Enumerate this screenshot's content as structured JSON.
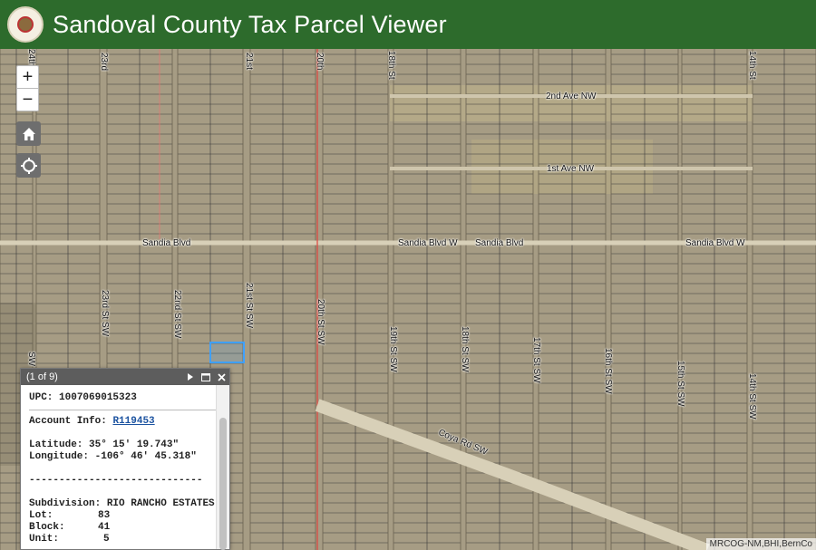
{
  "header": {
    "title": "Sandoval County Tax Parcel Viewer"
  },
  "map": {
    "attribution": "MRCOG-NM,BHI,BernCo",
    "streets_horizontal": [
      {
        "id": "2nd-ave-nw",
        "label": "2nd Ave NW"
      },
      {
        "id": "1st-ave-nw",
        "label": "1st Ave NW"
      },
      {
        "id": "sandia-blvd-left",
        "label": "Sandia Blvd"
      },
      {
        "id": "sandia-blvd-w-1",
        "label": "Sandia Blvd W"
      },
      {
        "id": "sandia-blvd-mid",
        "label": "Sandia Blvd"
      },
      {
        "id": "sandia-blvd-w-2",
        "label": "Sandia Blvd W"
      },
      {
        "id": "coya-rd-sw",
        "label": "Coya Rd SW"
      }
    ],
    "streets_vertical": [
      {
        "id": "24th-top",
        "label": "24th"
      },
      {
        "id": "23rd-top",
        "label": "23rd"
      },
      {
        "id": "21st-top",
        "label": "21st"
      },
      {
        "id": "20th-top",
        "label": "20th"
      },
      {
        "id": "18th-st-top",
        "label": "18th St"
      },
      {
        "id": "14th-st-top",
        "label": "14th St"
      },
      {
        "id": "23rd-st-sw",
        "label": "23rd St SW"
      },
      {
        "id": "22nd-st-sw",
        "label": "22nd St SW"
      },
      {
        "id": "21st-st-sw",
        "label": "21st St SW"
      },
      {
        "id": "20th-st-sw",
        "label": "20th St SW"
      },
      {
        "id": "19th-st-sw",
        "label": "19th St SW"
      },
      {
        "id": "18th-st-sw",
        "label": "18th St SW"
      },
      {
        "id": "17th-st-sw",
        "label": "17th St SW"
      },
      {
        "id": "16th-st-sw",
        "label": "16th St SW"
      },
      {
        "id": "15th-st-sw",
        "label": "15th St SW"
      },
      {
        "id": "14th-st-sw",
        "label": "14th St SW"
      },
      {
        "id": "sw-left",
        "label": "SW"
      }
    ]
  },
  "controls": {
    "zoom_in": "+",
    "zoom_out": "−",
    "home_icon": "home-icon",
    "locate_icon": "locate-icon"
  },
  "popup": {
    "pager": "(1 of 9)",
    "upc_label": "UPC:",
    "upc_value": "1007069015323",
    "account_label": "Account Info:",
    "account_value": "R119453",
    "latitude_label": "Latitude:",
    "latitude_value": "35° 15' 19.743\"",
    "longitude_label": "Longitude:",
    "longitude_value": "-106° 46' 45.318\"",
    "divider": "-----------------------------",
    "subdivision_label": "Subdivision:",
    "subdivision_value": "RIO RANCHO ESTATES",
    "lot_label": "Lot:",
    "lot_value": "83",
    "block_label": "Block:",
    "block_value": "41",
    "unit_label": "Unit:",
    "unit_value": "5"
  },
  "colors": {
    "header_bg": "#2d6b2c",
    "parcel_line": "#3a3a3a",
    "county_line": "#e0443e",
    "selected_parcel": "#3fa0ff"
  }
}
